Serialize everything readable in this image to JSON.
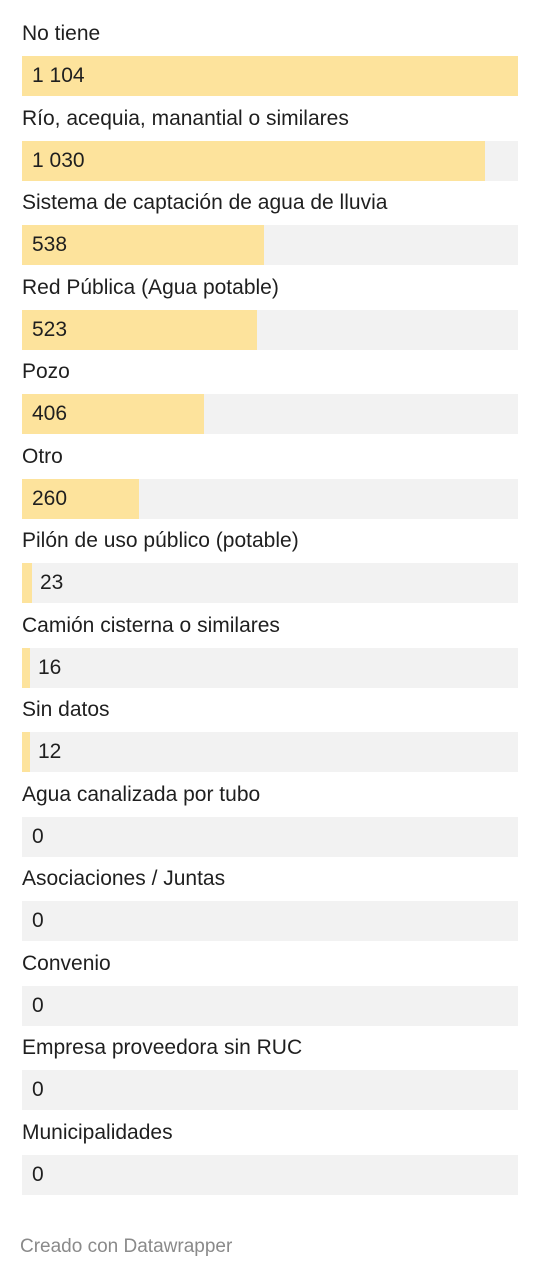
{
  "chart_data": {
    "type": "bar",
    "orientation": "horizontal",
    "categories": [
      "No tiene",
      "Río, acequia, manantial o similares",
      "Sistema de captación de agua de lluvia",
      "Red Pública (Agua potable)",
      "Pozo",
      "Otro",
      "Pilón de uso público (potable)",
      "Camión cisterna o similares",
      "Sin datos",
      "Agua canalizada por tubo",
      "Asociaciones / Juntas",
      "Convenio",
      "Empresa proveedora sin RUC",
      "Municipalidades"
    ],
    "values": [
      1104,
      1030,
      538,
      523,
      406,
      260,
      23,
      16,
      12,
      0,
      0,
      0,
      0,
      0
    ],
    "value_labels": [
      "1 104",
      "1 030",
      "538",
      "523",
      "406",
      "260",
      "23",
      "16",
      "12",
      "0",
      "0",
      "0",
      "0",
      "0"
    ],
    "xlim": [
      0,
      1104
    ],
    "bar_color": "#fde39c",
    "track_color": "#f2f2f2"
  },
  "footer": {
    "credit": "Creado con Datawrapper"
  }
}
